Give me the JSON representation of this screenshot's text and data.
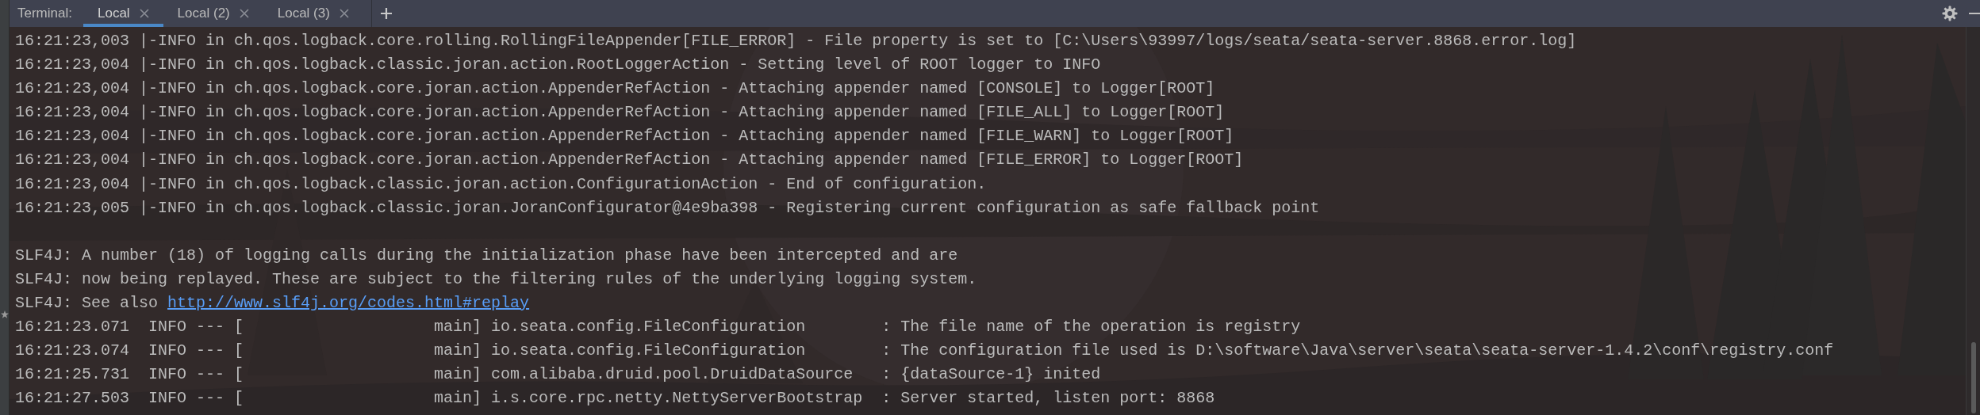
{
  "tool_window": {
    "title": "Terminal:"
  },
  "tabs": [
    {
      "label": "Local",
      "selected": true
    },
    {
      "label": "Local (2)",
      "selected": false
    },
    {
      "label": "Local (3)",
      "selected": false
    }
  ],
  "lines": [
    {
      "kind": "text",
      "text": "16:21:23,003 |-INFO in ch.qos.logback.core.rolling.RollingFileAppender[FILE_ERROR] - File property is set to [C:\\Users\\93997/logs/seata/seata-server.8868.error.log]"
    },
    {
      "kind": "text",
      "text": "16:21:23,004 |-INFO in ch.qos.logback.classic.joran.action.RootLoggerAction - Setting level of ROOT logger to INFO"
    },
    {
      "kind": "text",
      "text": "16:21:23,004 |-INFO in ch.qos.logback.core.joran.action.AppenderRefAction - Attaching appender named [CONSOLE] to Logger[ROOT]"
    },
    {
      "kind": "text",
      "text": "16:21:23,004 |-INFO in ch.qos.logback.core.joran.action.AppenderRefAction - Attaching appender named [FILE_ALL] to Logger[ROOT]"
    },
    {
      "kind": "text",
      "text": "16:21:23,004 |-INFO in ch.qos.logback.core.joran.action.AppenderRefAction - Attaching appender named [FILE_WARN] to Logger[ROOT]"
    },
    {
      "kind": "text",
      "text": "16:21:23,004 |-INFO in ch.qos.logback.core.joran.action.AppenderRefAction - Attaching appender named [FILE_ERROR] to Logger[ROOT]"
    },
    {
      "kind": "text",
      "text": "16:21:23,004 |-INFO in ch.qos.logback.classic.joran.action.ConfigurationAction - End of configuration."
    },
    {
      "kind": "text",
      "text": "16:21:23,005 |-INFO in ch.qos.logback.classic.joran.JoranConfigurator@4e9ba398 - Registering current configuration as safe fallback point"
    },
    {
      "kind": "blank"
    },
    {
      "kind": "text",
      "text": "SLF4J: A number (18) of logging calls during the initialization phase have been intercepted and are"
    },
    {
      "kind": "text",
      "text": "SLF4J: now being replayed. These are subject to the filtering rules of the underlying logging system."
    },
    {
      "kind": "link",
      "text": "SLF4J: See also",
      "link": "http://www.slf4j.org/codes.html#replay"
    },
    {
      "kind": "text",
      "text": "16:21:23.071  INFO --- [                    main] io.seata.config.FileConfiguration        : The file name of the operation is registry"
    },
    {
      "kind": "text",
      "text": "16:21:23.074  INFO --- [                    main] io.seata.config.FileConfiguration        : The configuration file used is D:\\software\\Java\\server\\seata\\seata-server-1.4.2\\conf\\registry.conf"
    },
    {
      "kind": "text",
      "text": "16:21:25.731  INFO --- [                    main] com.alibaba.druid.pool.DruidDataSource   : {dataSource-1} inited"
    },
    {
      "kind": "text",
      "text": "16:21:27.503  INFO --- [                    main] i.s.core.rpc.netty.NettyServerBootstrap  : Server started, listen port: 8868"
    }
  ]
}
